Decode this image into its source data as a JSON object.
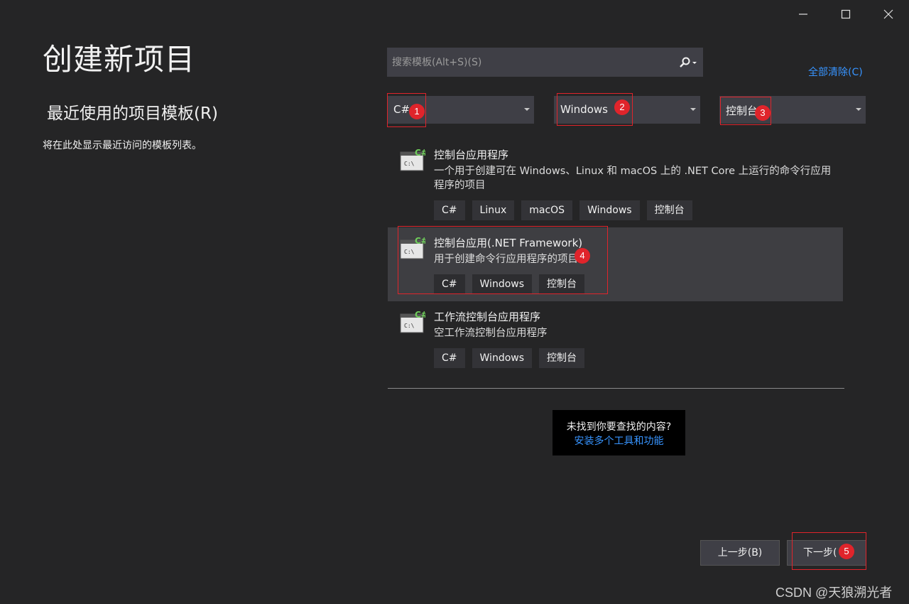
{
  "page": {
    "title": "创建新项目",
    "recent_title": "最近使用的项目模板(R)",
    "recent_desc": "将在此处显示最近访问的模板列表。"
  },
  "search": {
    "placeholder": "搜索模板(Alt+S)(S)",
    "clear_all": "全部清除(C)"
  },
  "filters": {
    "language": "C#",
    "platform": "Windows",
    "project_type": "控制台"
  },
  "templates": [
    {
      "title": "控制台应用程序",
      "desc": "一个用于创建可在 Windows、Linux 和 macOS 上的 .NET Core 上运行的命令行应用程序的项目",
      "tags": [
        "C#",
        "Linux",
        "macOS",
        "Windows",
        "控制台"
      ],
      "icon": "console-csharp-icon",
      "selected": false
    },
    {
      "title": "控制台应用(.NET Framework)",
      "desc": "用于创建命令行应用程序的项目",
      "tags": [
        "C#",
        "Windows",
        "控制台"
      ],
      "icon": "console-csharp-icon",
      "selected": true
    },
    {
      "title": "工作流控制台应用程序",
      "desc": "空工作流控制台应用程序",
      "tags": [
        "C#",
        "Windows",
        "控制台"
      ],
      "icon": "console-csharp-icon",
      "selected": false
    }
  ],
  "not_found": {
    "question": "未找到你要查找的内容?",
    "link": "安装多个工具和功能"
  },
  "buttons": {
    "back": "上一步(B)",
    "next": "下一步("
  },
  "annotations": [
    "1",
    "2",
    "3",
    "4",
    "5"
  ],
  "watermark": "CSDN @天狼溯光者",
  "colors": {
    "background": "#252526",
    "accent_link": "#3794ff",
    "annotation_red": "#e0242b",
    "selected_row": "#3e3e42"
  }
}
